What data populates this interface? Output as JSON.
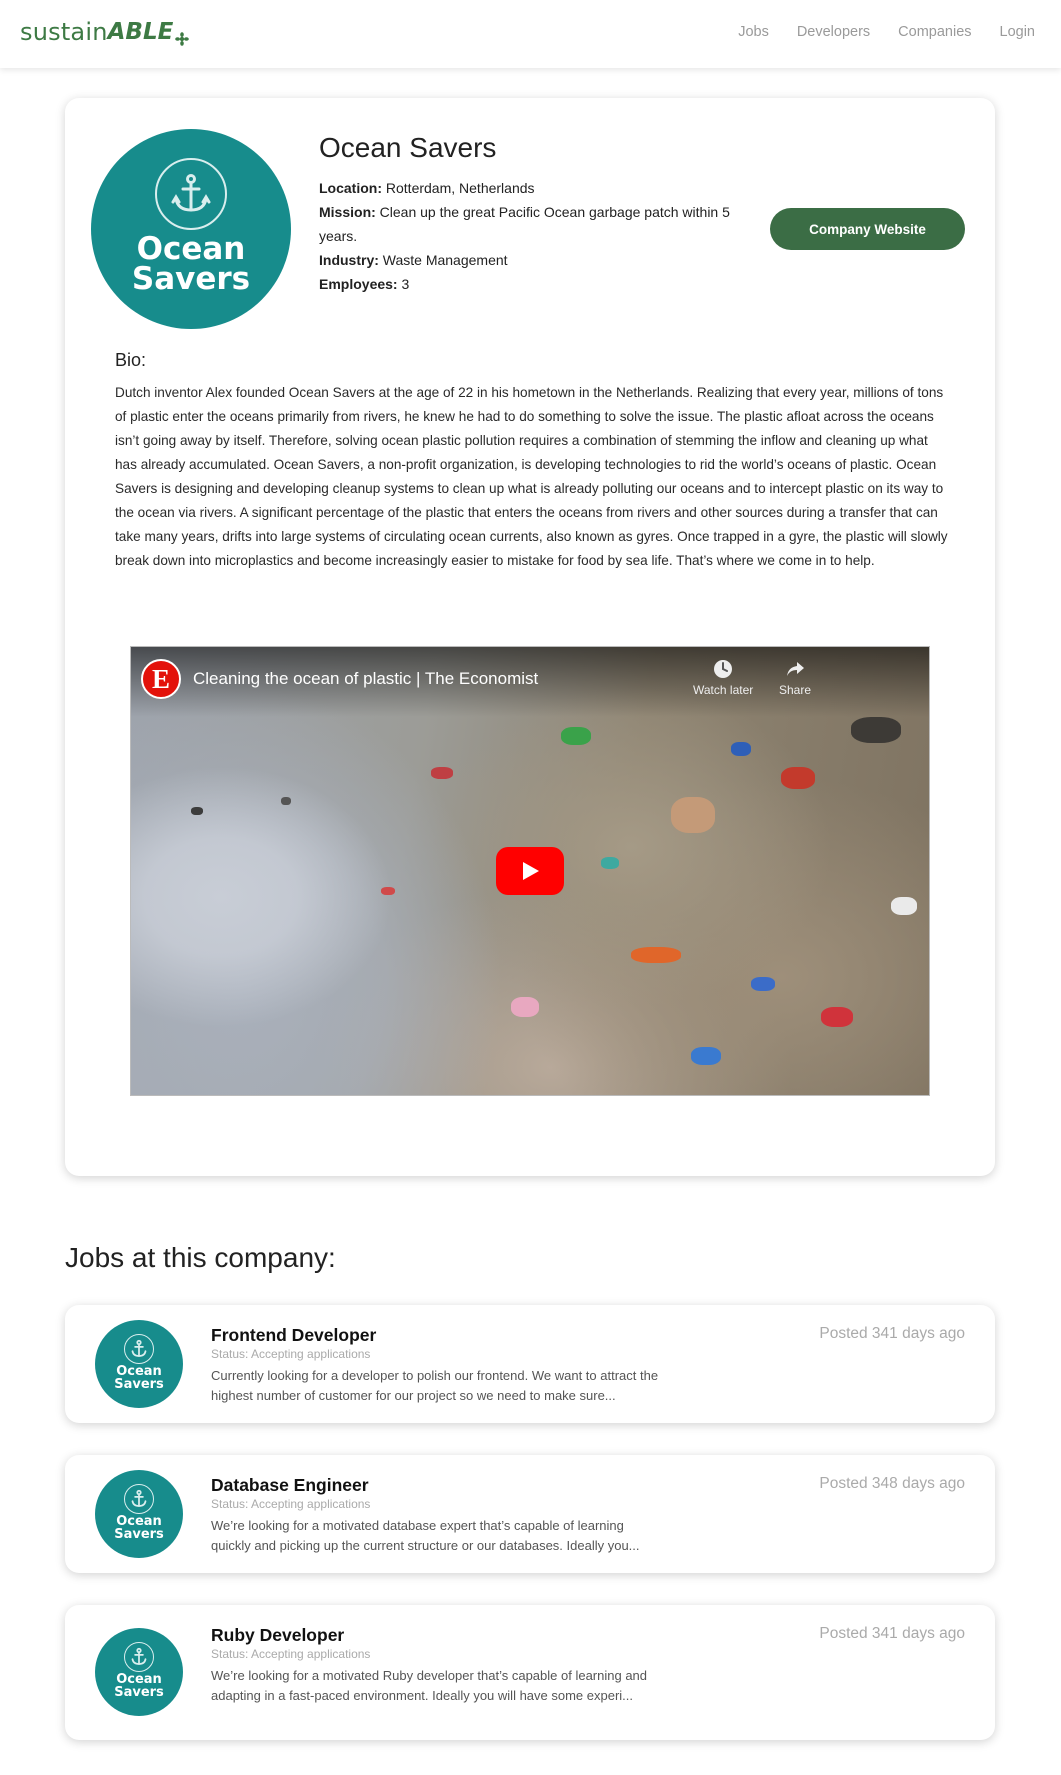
{
  "navbar": {
    "logo_light": "sustain",
    "logo_bold": "ABLE",
    "links": [
      "Jobs",
      "Developers",
      "Companies",
      "Login"
    ]
  },
  "company": {
    "logo_line1": "Ocean",
    "logo_line2": "Savers",
    "name": "Ocean Savers",
    "location_label": "Location:",
    "location": "Rotterdam, Netherlands",
    "mission_label": "Mission:",
    "mission": "Clean up the great Pacific Ocean garbage patch within 5 years.",
    "industry_label": "Industry:",
    "industry": "Waste Management",
    "employees_label": "Employees:",
    "employees": "3",
    "website_button": "Company Website",
    "bio_title": "Bio:",
    "bio": "Dutch inventor Alex founded Ocean Savers at the age of 22 in his hometown in the Netherlands. Realizing that every year, millions of tons of plastic enter the oceans primarily from rivers, he knew he had to do something to solve the issue. The plastic afloat across the oceans isn’t going away by itself. Therefore, solving ocean plastic pollution requires a combination of stemming the inflow and cleaning up what has already accumulated. Ocean Savers, a non-profit organization, is developing technologies to rid the world’s oceans of plastic. Ocean Savers is designing and developing cleanup systems to clean up what is already polluting our oceans and to intercept plastic on its way to the ocean via rivers. A significant percentage of the plastic that enters the oceans from rivers and other sources during a transfer that can take many years, drifts into large systems of circulating ocean currents, also known as gyres. Once trapped in a gyre, the plastic will slowly break down into microplastics and become increasingly easier to mistake for food by sea life. That’s where we come in to help."
  },
  "video": {
    "channel_letter": "E",
    "title": "Cleaning the ocean of plastic | The Economist",
    "watch_later": "Watch later",
    "share": "Share"
  },
  "jobs": {
    "heading": "Jobs at this company:",
    "items": [
      {
        "title": "Frontend Developer",
        "status": "Status: Accepting applications",
        "description": "Currently looking for a developer to polish our frontend. We want to attract the highest number of customer for our project so we need to make sure...",
        "posted": "Posted 341 days ago"
      },
      {
        "title": "Database Engineer",
        "status": "Status: Accepting applications",
        "description": "We’re looking for a motivated database expert that’s capable of learning quickly and picking up the current structure or our databases. Ideally you...",
        "posted": "Posted 348 days ago"
      },
      {
        "title": "Ruby Developer",
        "status": "Status: Accepting applications",
        "description": "We’re looking for a motivated Ruby developer that’s capable of learning and adapting in a fast-paced environment. Ideally you will have some experi...",
        "posted": "Posted 341 days ago"
      }
    ]
  },
  "colors": {
    "brand_green": "#3d7a44",
    "button_green": "#3b6d45",
    "teal": "#178c8c",
    "youtube_red": "#ff0000"
  }
}
